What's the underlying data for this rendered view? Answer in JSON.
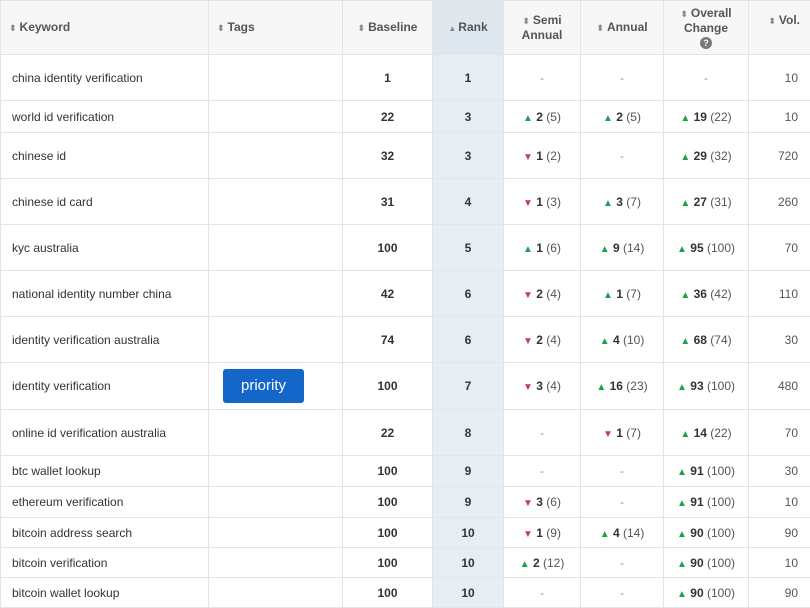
{
  "headers": {
    "keyword": "Keyword",
    "tags": "Tags",
    "baseline": "Baseline",
    "rank": "Rank",
    "semi_annual_line1": "Semi",
    "semi_annual_line2": "Annual",
    "annual": "Annual",
    "overall_line1": "Overall",
    "overall_line2": "Change",
    "volume": "Vol.",
    "help_glyph": "?"
  },
  "icons": {
    "sort": "sort-both-icon",
    "sort_active": "sort-asc-icon",
    "help": "help-circle-icon",
    "up": "arrow-up-icon",
    "down": "arrow-down-icon"
  },
  "colors": {
    "up": "#1aa34a",
    "down": "#c9385a",
    "tag": "#1466c8",
    "rank_col": "#e6eef4"
  },
  "rows": [
    {
      "keyword": "china identity verification",
      "tag": "",
      "baseline": "1",
      "rank": "1",
      "semi": {
        "dir": "",
        "val": "",
        "paren": ""
      },
      "annual": {
        "dir": "",
        "val": "",
        "paren": ""
      },
      "overall": {
        "dir": "",
        "val": "",
        "paren": ""
      },
      "vol": "10"
    },
    {
      "keyword": "world id verification",
      "tag": "",
      "baseline": "22",
      "rank": "3",
      "semi": {
        "dir": "up",
        "val": "2",
        "paren": "(5)"
      },
      "annual": {
        "dir": "up",
        "val": "2",
        "paren": "(5)"
      },
      "overall": {
        "dir": "up",
        "val": "19",
        "paren": "(22)"
      },
      "vol": "10"
    },
    {
      "keyword": "chinese id",
      "tag": "",
      "baseline": "32",
      "rank": "3",
      "semi": {
        "dir": "down",
        "val": "1",
        "paren": "(2)"
      },
      "annual": {
        "dir": "",
        "val": "",
        "paren": ""
      },
      "overall": {
        "dir": "up",
        "val": "29",
        "paren": "(32)"
      },
      "vol": "720"
    },
    {
      "keyword": "chinese id card",
      "tag": "",
      "baseline": "31",
      "rank": "4",
      "semi": {
        "dir": "down",
        "val": "1",
        "paren": "(3)"
      },
      "annual": {
        "dir": "up",
        "val": "3",
        "paren": "(7)"
      },
      "overall": {
        "dir": "up",
        "val": "27",
        "paren": "(31)"
      },
      "vol": "260"
    },
    {
      "keyword": "kyc australia",
      "tag": "",
      "baseline": "100",
      "rank": "5",
      "semi": {
        "dir": "up",
        "val": "1",
        "paren": "(6)"
      },
      "annual": {
        "dir": "up",
        "val": "9",
        "paren": "(14)"
      },
      "overall": {
        "dir": "up",
        "val": "95",
        "paren": "(100)"
      },
      "vol": "70"
    },
    {
      "keyword": "national identity number china",
      "tag": "",
      "baseline": "42",
      "rank": "6",
      "semi": {
        "dir": "down",
        "val": "2",
        "paren": "(4)"
      },
      "annual": {
        "dir": "up",
        "val": "1",
        "paren": "(7)"
      },
      "overall": {
        "dir": "up",
        "val": "36",
        "paren": "(42)"
      },
      "vol": "110"
    },
    {
      "keyword": "identity verification australia",
      "tag": "",
      "baseline": "74",
      "rank": "6",
      "semi": {
        "dir": "down",
        "val": "2",
        "paren": "(4)"
      },
      "annual": {
        "dir": "up",
        "val": "4",
        "paren": "(10)"
      },
      "overall": {
        "dir": "up",
        "val": "68",
        "paren": "(74)"
      },
      "vol": "30"
    },
    {
      "keyword": "identity verification",
      "tag": "priority",
      "baseline": "100",
      "rank": "7",
      "semi": {
        "dir": "down",
        "val": "3",
        "paren": "(4)"
      },
      "annual": {
        "dir": "up",
        "val": "16",
        "paren": "(23)"
      },
      "overall": {
        "dir": "up",
        "val": "93",
        "paren": "(100)"
      },
      "vol": "480"
    },
    {
      "keyword": "online id verification australia",
      "tag": "",
      "baseline": "22",
      "rank": "8",
      "semi": {
        "dir": "",
        "val": "",
        "paren": ""
      },
      "annual": {
        "dir": "down",
        "val": "1",
        "paren": "(7)"
      },
      "overall": {
        "dir": "up",
        "val": "14",
        "paren": "(22)"
      },
      "vol": "70"
    },
    {
      "keyword": "btc wallet lookup",
      "tag": "",
      "baseline": "100",
      "rank": "9",
      "semi": {
        "dir": "",
        "val": "",
        "paren": ""
      },
      "annual": {
        "dir": "",
        "val": "",
        "paren": ""
      },
      "overall": {
        "dir": "up",
        "val": "91",
        "paren": "(100)"
      },
      "vol": "30"
    },
    {
      "keyword": "ethereum verification",
      "tag": "",
      "baseline": "100",
      "rank": "9",
      "semi": {
        "dir": "down",
        "val": "3",
        "paren": "(6)"
      },
      "annual": {
        "dir": "",
        "val": "",
        "paren": ""
      },
      "overall": {
        "dir": "up",
        "val": "91",
        "paren": "(100)"
      },
      "vol": "10"
    },
    {
      "keyword": "bitcoin address search",
      "tag": "",
      "baseline": "100",
      "rank": "10",
      "semi": {
        "dir": "down",
        "val": "1",
        "paren": "(9)"
      },
      "annual": {
        "dir": "up",
        "val": "4",
        "paren": "(14)"
      },
      "overall": {
        "dir": "up",
        "val": "90",
        "paren": "(100)"
      },
      "vol": "90"
    },
    {
      "keyword": "bitcoin verification",
      "tag": "",
      "baseline": "100",
      "rank": "10",
      "semi": {
        "dir": "up",
        "val": "2",
        "paren": "(12)"
      },
      "annual": {
        "dir": "",
        "val": "",
        "paren": ""
      },
      "overall": {
        "dir": "up",
        "val": "90",
        "paren": "(100)"
      },
      "vol": "10"
    },
    {
      "keyword": "bitcoin wallet lookup",
      "tag": "",
      "baseline": "100",
      "rank": "10",
      "semi": {
        "dir": "",
        "val": "",
        "paren": ""
      },
      "annual": {
        "dir": "",
        "val": "",
        "paren": ""
      },
      "overall": {
        "dir": "up",
        "val": "90",
        "paren": "(100)"
      },
      "vol": "90"
    }
  ]
}
